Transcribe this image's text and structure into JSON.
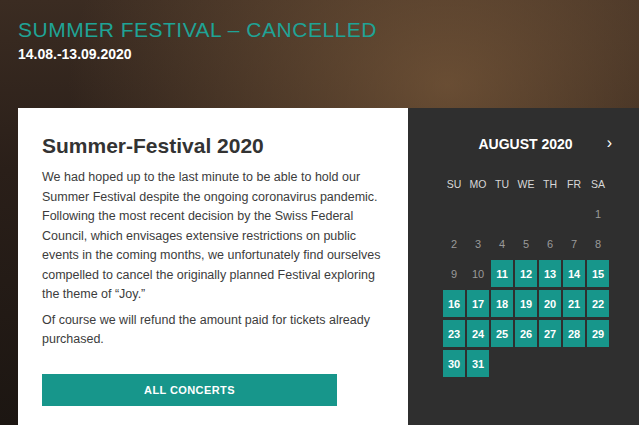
{
  "banner": {
    "title": "SUMMER FESTIVAL – CANCELLED",
    "dates": "14.08.-13.09.2020"
  },
  "notice": {
    "heading": "Summer-Festival 2020",
    "paragraphs": [
      "We had hoped up to the last minute to be able to hold our Summer Festival despite the ongoing coronavirus pandemic. Following the most recent decision by the Swiss Federal Council, which envisages extensive restrictions on public events in the coming months, we unfortunately find ourselves compelled to cancel the originally planned Festival exploring the theme of “Joy.”",
      "Of course we will refund the amount paid for tickets already purchased."
    ],
    "button": "ALL CONCERTS"
  },
  "calendar": {
    "month": "AUGUST 2020",
    "next": "›",
    "weekdays": [
      "SU",
      "MO",
      "TU",
      "WE",
      "TH",
      "FR",
      "SA"
    ],
    "weeks": [
      [
        null,
        null,
        null,
        null,
        null,
        null,
        {
          "day": "1",
          "festival": false
        }
      ],
      [
        {
          "day": "2",
          "festival": false
        },
        {
          "day": "3",
          "festival": false
        },
        {
          "day": "4",
          "festival": false
        },
        {
          "day": "5",
          "festival": false
        },
        {
          "day": "6",
          "festival": false
        },
        {
          "day": "7",
          "festival": false
        },
        {
          "day": "8",
          "festival": false
        }
      ],
      [
        {
          "day": "9",
          "festival": false
        },
        {
          "day": "10",
          "festival": false
        },
        {
          "day": "11",
          "festival": true
        },
        {
          "day": "12",
          "festival": true
        },
        {
          "day": "13",
          "festival": true
        },
        {
          "day": "14",
          "festival": true
        },
        {
          "day": "15",
          "festival": true
        }
      ],
      [
        {
          "day": "16",
          "festival": true
        },
        {
          "day": "17",
          "festival": true
        },
        {
          "day": "18",
          "festival": true
        },
        {
          "day": "19",
          "festival": true
        },
        {
          "day": "20",
          "festival": true
        },
        {
          "day": "21",
          "festival": true
        },
        {
          "day": "22",
          "festival": true
        }
      ],
      [
        {
          "day": "23",
          "festival": true
        },
        {
          "day": "24",
          "festival": true
        },
        {
          "day": "25",
          "festival": true
        },
        {
          "day": "26",
          "festival": true
        },
        {
          "day": "27",
          "festival": true
        },
        {
          "day": "28",
          "festival": true
        },
        {
          "day": "29",
          "festival": true
        }
      ],
      [
        {
          "day": "30",
          "festival": true
        },
        {
          "day": "31",
          "festival": true
        },
        null,
        null,
        null,
        null,
        null
      ]
    ]
  }
}
